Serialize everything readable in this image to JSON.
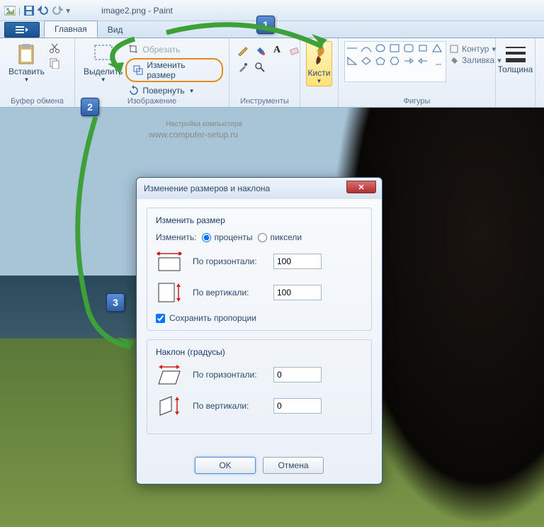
{
  "title": "image2.png - Paint",
  "tabs": {
    "home": "Главная",
    "view": "Вид"
  },
  "groups": {
    "clipboard": "Буфер обмена",
    "image": "Изображение",
    "tools": "Инструменты",
    "brushes": "Кисти",
    "shapes": "Фигуры",
    "size": "Толщина"
  },
  "buttons": {
    "paste": "Вставить",
    "select": "Выделить",
    "crop": "Обрезать",
    "resize": "Изменить размер",
    "rotate": "Повернуть",
    "outline": "Контур",
    "fill": "Заливка"
  },
  "watermark": {
    "line1": "Настройка компьютера",
    "line2": "www.computer-setup.ru"
  },
  "steps": {
    "s1": "1",
    "s2": "2",
    "s3": "3"
  },
  "dialog": {
    "title": "Изменение размеров и наклона",
    "resize_legend": "Изменить размер",
    "by_label": "Изменить:",
    "percent": "проценты",
    "pixels": "пиксели",
    "horizontal": "По горизонтали:",
    "vertical": "По вертикали:",
    "h_val": "100",
    "v_val": "100",
    "keep_ratio": "Сохранить пропорции",
    "skew_legend": "Наклон (градусы)",
    "skew_h": "0",
    "skew_v": "0",
    "ok": "OK",
    "cancel": "Отмена"
  }
}
